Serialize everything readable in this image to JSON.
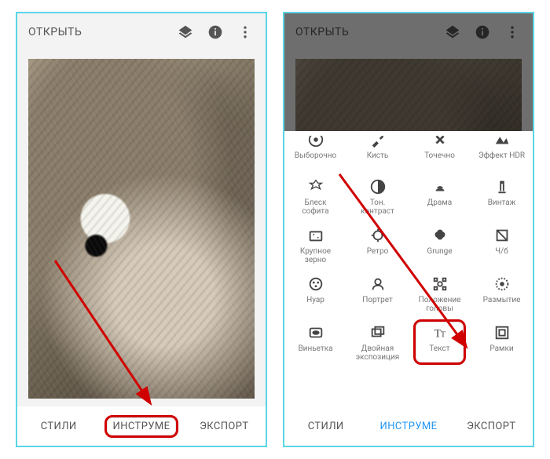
{
  "header": {
    "open_label": "ОТКРЫТЬ"
  },
  "tabs": {
    "styles": "СТИЛИ",
    "tools": "ИНСТРУМЕ",
    "export": "ЭКСПОРТ"
  },
  "icons": {
    "layers": "layers",
    "info": "info",
    "menu": "more-vert"
  },
  "tools_panel": {
    "rows": [
      [
        {
          "id": "selective",
          "label": "Выборочно"
        },
        {
          "id": "brush",
          "label": "Кисть"
        },
        {
          "id": "healing",
          "label": "Точечно"
        },
        {
          "id": "hdr",
          "label": "Эффект HDR"
        }
      ],
      [
        {
          "id": "glamour",
          "label": "Блеск\nсофита"
        },
        {
          "id": "tonal",
          "label": "Тон.\nконтраст"
        },
        {
          "id": "drama",
          "label": "Драма"
        },
        {
          "id": "vintage",
          "label": "Винтаж"
        }
      ],
      [
        {
          "id": "grainy",
          "label": "Крупное\nзерно"
        },
        {
          "id": "retro",
          "label": "Ретро"
        },
        {
          "id": "grunge",
          "label": "Grunge"
        },
        {
          "id": "bw",
          "label": "Ч/б"
        }
      ],
      [
        {
          "id": "noir",
          "label": "Нуар"
        },
        {
          "id": "portrait",
          "label": "Портрет"
        },
        {
          "id": "headpose",
          "label": "Положение\nголовы"
        },
        {
          "id": "blur",
          "label": "Размытие"
        }
      ],
      [
        {
          "id": "vignette",
          "label": "Виньетка"
        },
        {
          "id": "double",
          "label": "Двойная\nэкспозиция"
        },
        {
          "id": "text",
          "label": "Текст"
        },
        {
          "id": "frames",
          "label": "Рамки"
        }
      ]
    ]
  },
  "highlight": {
    "screen1_tab": "tools",
    "screen2_tool": "text"
  }
}
